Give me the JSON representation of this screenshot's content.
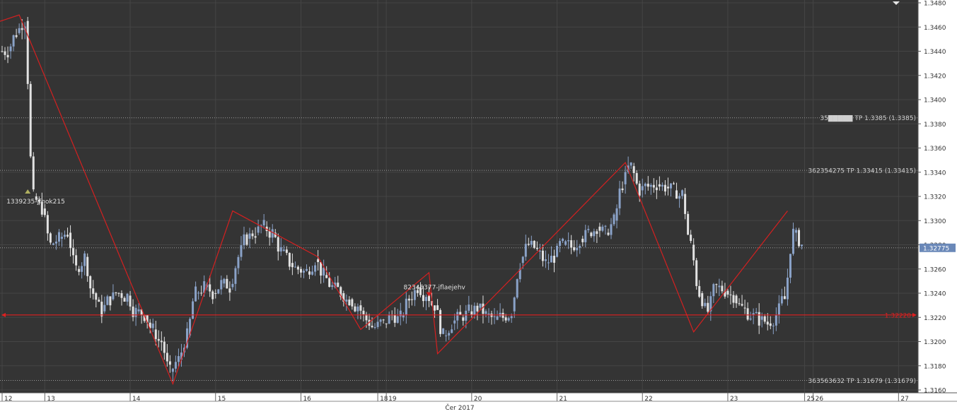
{
  "chart_data": {
    "type": "candlestick",
    "ylim": [
      1.316,
      1.348
    ],
    "y_ticks": [
      "1.3480",
      "1.3460",
      "1.3440",
      "1.3420",
      "1.3400",
      "1.3380",
      "1.3360",
      "1.3340",
      "1.3320",
      "1.3300",
      "1.3280",
      "1.3260",
      "1.3240",
      "1.3220",
      "1.3200",
      "1.3180",
      "1.3160"
    ],
    "x_ticks": [
      {
        "label": "12",
        "x": 0
      },
      {
        "label": "13",
        "x": 5
      },
      {
        "label": "14",
        "x": 15
      },
      {
        "label": "15",
        "x": 25
      },
      {
        "label": "16",
        "x": 35
      },
      {
        "label": "18",
        "x": 44
      },
      {
        "label": "19",
        "x": 45
      },
      {
        "label": "20",
        "x": 55
      },
      {
        "label": "21",
        "x": 65
      },
      {
        "label": "22",
        "x": 75
      },
      {
        "label": "23",
        "x": 85
      },
      {
        "label": "25",
        "x": 94
      },
      {
        "label": "26",
        "x": 95
      },
      {
        "label": "27",
        "x": 105
      }
    ],
    "x_range": [
      0,
      110
    ],
    "month_label": "Čer 2017",
    "current_price": "1.32775",
    "current_value": 1.32775,
    "candles_seed": [
      [
        0,
        1.344
      ],
      [
        1,
        1.3455
      ],
      [
        2,
        1.3465
      ],
      [
        3,
        1.332
      ],
      [
        4,
        1.331
      ],
      [
        5,
        1.328
      ],
      [
        6,
        1.3285
      ],
      [
        7,
        1.329
      ],
      [
        8,
        1.326
      ],
      [
        9,
        1.327
      ],
      [
        10,
        1.324
      ],
      [
        11,
        1.3225
      ],
      [
        12,
        1.3235
      ],
      [
        13,
        1.324
      ],
      [
        14,
        1.3238
      ],
      [
        15,
        1.3225
      ],
      [
        16,
        1.3222
      ],
      [
        17,
        1.321
      ],
      [
        18,
        1.32
      ],
      [
        19,
        1.3175
      ],
      [
        20,
        1.3185
      ],
      [
        21,
        1.3205
      ],
      [
        22,
        1.324
      ],
      [
        23,
        1.3245
      ],
      [
        24,
        1.324
      ],
      [
        25,
        1.3248
      ],
      [
        26,
        1.3245
      ],
      [
        27,
        1.327
      ],
      [
        28,
        1.3285
      ],
      [
        29,
        1.329
      ],
      [
        30,
        1.3295
      ],
      [
        31,
        1.329
      ],
      [
        32,
        1.3275
      ],
      [
        33,
        1.3265
      ],
      [
        34,
        1.326
      ],
      [
        35,
        1.3258
      ],
      [
        36,
        1.3268
      ],
      [
        37,
        1.3255
      ],
      [
        38,
        1.3245
      ],
      [
        39,
        1.324
      ],
      [
        40,
        1.3235
      ],
      [
        41,
        1.323
      ],
      [
        42,
        1.3218
      ],
      [
        43,
        1.3212
      ],
      [
        44,
        1.3215
      ],
      [
        45,
        1.3222
      ],
      [
        46,
        1.322
      ],
      [
        47,
        1.3235
      ],
      [
        48,
        1.3245
      ],
      [
        49,
        1.324
      ],
      [
        50,
        1.323
      ],
      [
        51,
        1.3205
      ],
      [
        52,
        1.3215
      ],
      [
        53,
        1.322
      ],
      [
        54,
        1.3225
      ],
      [
        55,
        1.3228
      ],
      [
        56,
        1.3222
      ],
      [
        57,
        1.3218
      ],
      [
        58,
        1.322
      ],
      [
        59,
        1.3225
      ],
      [
        60,
        1.3265
      ],
      [
        61,
        1.328
      ],
      [
        62,
        1.3275
      ],
      [
        63,
        1.3265
      ],
      [
        64,
        1.327
      ],
      [
        65,
        1.328
      ],
      [
        66,
        1.3278
      ],
      [
        67,
        1.3285
      ],
      [
        68,
        1.329
      ],
      [
        69,
        1.3295
      ],
      [
        70,
        1.329
      ],
      [
        71,
        1.33
      ],
      [
        72,
        1.333
      ],
      [
        73,
        1.3345
      ],
      [
        74,
        1.3325
      ],
      [
        75,
        1.3328
      ],
      [
        76,
        1.333
      ],
      [
        77,
        1.3328
      ],
      [
        78,
        1.3325
      ],
      [
        79,
        1.3322
      ],
      [
        80,
        1.328
      ],
      [
        81,
        1.324
      ],
      [
        82,
        1.3225
      ],
      [
        83,
        1.3245
      ],
      [
        84,
        1.3242
      ],
      [
        85,
        1.3238
      ],
      [
        86,
        1.3228
      ],
      [
        87,
        1.3222
      ],
      [
        88,
        1.3218
      ],
      [
        89,
        1.3215
      ],
      [
        90,
        1.3222
      ],
      [
        91,
        1.3235
      ],
      [
        92,
        1.329
      ],
      [
        93,
        1.328
      ]
    ],
    "zigzag": [
      [
        -1,
        1.3463
      ],
      [
        2,
        1.347
      ],
      [
        20,
        1.3165
      ],
      [
        27,
        1.3308
      ],
      [
        37,
        1.327
      ],
      [
        42,
        1.321
      ],
      [
        50,
        1.3257
      ],
      [
        51,
        1.319
      ],
      [
        73,
        1.3348
      ],
      [
        81,
        1.3208
      ],
      [
        92,
        1.3308
      ]
    ],
    "horizontal_line": {
      "value": 1.3222,
      "label": "1.32220",
      "color": "#e02020"
    },
    "tp_lines": [
      {
        "value": 1.3385,
        "label": "35▇▇▇▇▇ TP 1.3385 (1.3385)"
      },
      {
        "value": 1.33415,
        "label": "362354275 TP 1.33415 (1.33415)"
      },
      {
        "value": 1.31679,
        "label": "363563632 TP 1.31679 (1.31679)"
      }
    ],
    "current_price_line": {
      "value": 1.32775
    },
    "annotations": [
      {
        "text": "1339235-jfnok215",
        "x": 3,
        "y": 1.332
      },
      {
        "text": "82345377-jflaejehv",
        "x": 50,
        "y": 1.3242
      }
    ],
    "colors": {
      "background": "#343434",
      "grid": "#454545",
      "bull": "#8aa2c8",
      "bear": "#e2e2e2",
      "zigzag": "#d42020",
      "tp_line": "#9a9a9a",
      "axis_bg": "#ffffff",
      "price_tag": "#6a88b8"
    }
  }
}
